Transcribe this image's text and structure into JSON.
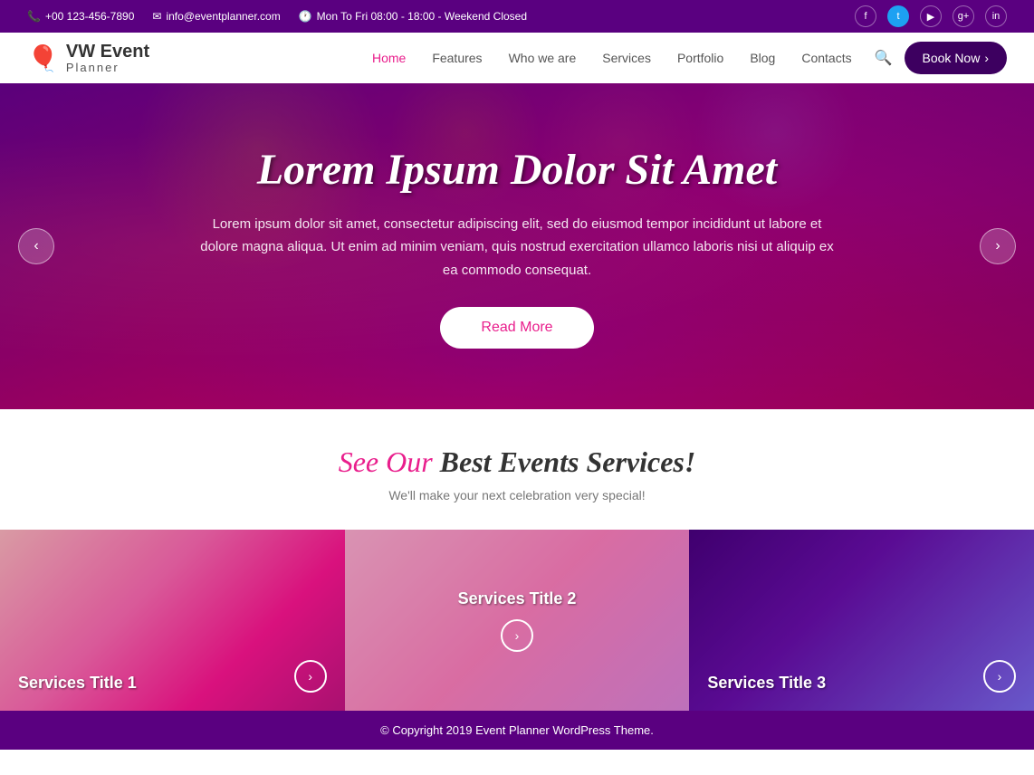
{
  "topbar": {
    "phone": "+00 123-456-7890",
    "email": "info@eventplanner.com",
    "hours": "Mon To Fri 08:00 - 18:00 - Weekend Closed",
    "social": [
      "facebook",
      "twitter",
      "youtube",
      "google-plus",
      "linkedin"
    ]
  },
  "header": {
    "brand": "VW Event",
    "sub": "Planner",
    "nav": [
      "Home",
      "Features",
      "Who we are",
      "Services",
      "Portfolio",
      "Blog",
      "Contacts"
    ],
    "book_btn": "Book Now"
  },
  "hero": {
    "title": "Lorem Ipsum Dolor Sit Amet",
    "text": "Lorem ipsum dolor sit amet, consectetur adipiscing elit, sed do eiusmod tempor incididunt ut labore et dolore magna aliqua.  Ut enim ad minim veniam, quis nostrud exercitation ullamco laboris nisi ut aliquip ex ea commodo consequat.",
    "cta": "Read More",
    "prev_arrow": "‹",
    "next_arrow": "›"
  },
  "services_section": {
    "title_part1": "See Our",
    "title_part2": " Best Events Services!",
    "subtitle": "We'll make your next celebration very special!",
    "cards": [
      {
        "title": "Services Title 1"
      },
      {
        "title": "Services Title 2"
      },
      {
        "title": "Services Title 3"
      }
    ]
  },
  "footer": {
    "text": "© Copyright 2019 Event Planner WordPress Theme."
  }
}
